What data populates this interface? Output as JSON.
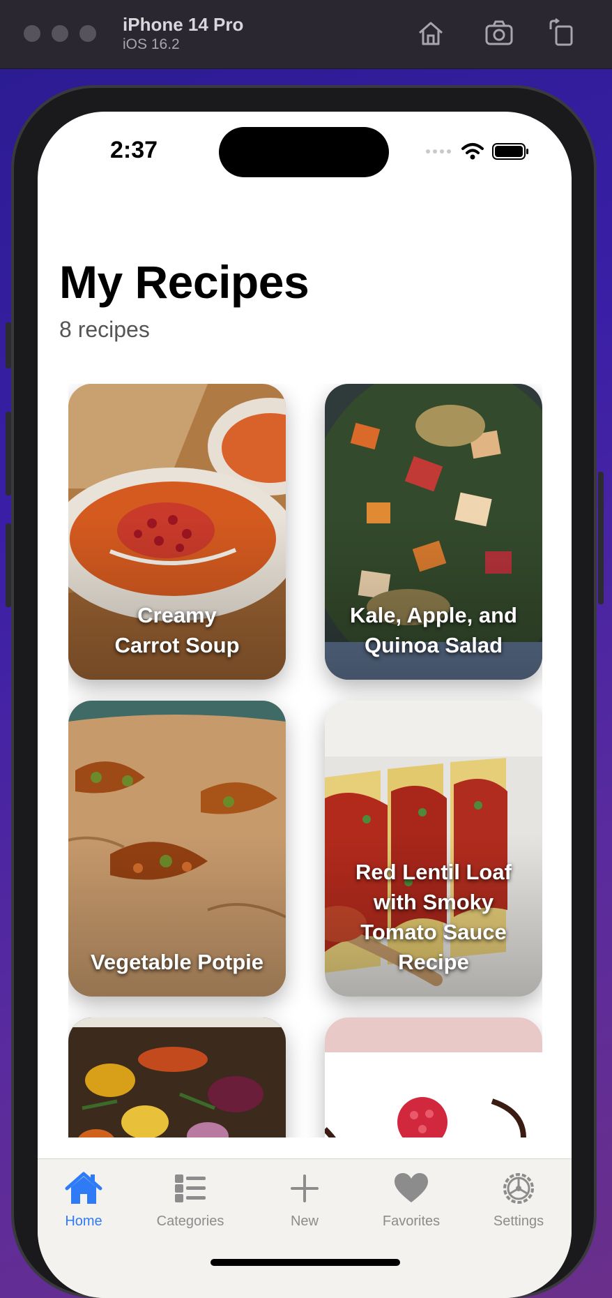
{
  "simulator": {
    "device": "iPhone 14 Pro",
    "os": "iOS 16.2"
  },
  "status_bar": {
    "time": "2:37"
  },
  "page": {
    "title": "My Recipes",
    "subtitle": "8 recipes"
  },
  "recipes": [
    {
      "title_lines": [
        "Creamy",
        "Carrot Soup"
      ]
    },
    {
      "title_lines": [
        "Kale, Apple, and",
        "Quinoa Salad"
      ]
    },
    {
      "title_lines": [
        "Vegetable Potpie"
      ]
    },
    {
      "title_lines": [
        "Red Lentil Loaf",
        "with Smoky",
        "Tomato Sauce",
        "Recipe"
      ]
    },
    {
      "title_lines": []
    },
    {
      "title_lines": []
    }
  ],
  "tabs": [
    {
      "label": "Home",
      "icon": "house-icon",
      "active": true
    },
    {
      "label": "Categories",
      "icon": "list-icon",
      "active": false
    },
    {
      "label": "New",
      "icon": "plus-icon",
      "active": false
    },
    {
      "label": "Favorites",
      "icon": "heart-icon",
      "active": false
    },
    {
      "label": "Settings",
      "icon": "gear-icon",
      "active": false
    }
  ],
  "colors": {
    "accent": "#2f7bf5",
    "inactive_tab": "#8c8c8c"
  }
}
